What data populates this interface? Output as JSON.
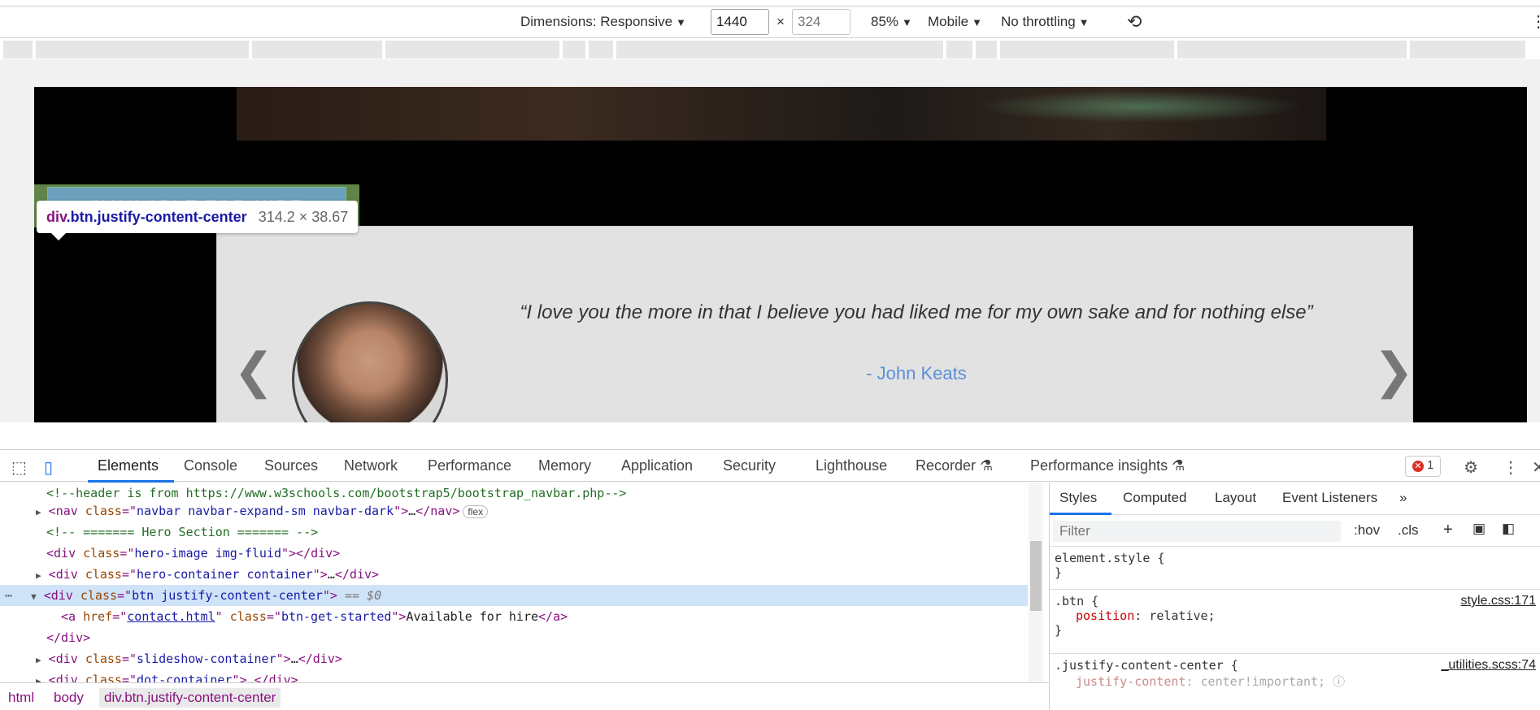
{
  "toolbar": {
    "dimensions_label": "Dimensions: Responsive",
    "width_value": "1440",
    "times": "×",
    "height_placeholder": "324",
    "zoom": "85%",
    "device_mode": "Mobile",
    "throttling": "No throttling"
  },
  "page": {
    "button_text": "Available for hire",
    "tooltip": {
      "selector_tag": "div",
      "selector_classes": ".btn.justify-content-center",
      "size": "314.2 × 38.67"
    },
    "slideshow": {
      "quote": "“I love you the more in that I believe you had liked me for my own sake and for nothing else”",
      "author": "- John Keats",
      "prev": "❮",
      "next": "❯"
    }
  },
  "devtools": {
    "tabs": [
      "Elements",
      "Console",
      "Sources",
      "Network",
      "Performance",
      "Memory",
      "Application",
      "Security",
      "Lighthouse",
      "Recorder",
      "Performance insights"
    ],
    "error_count": "1",
    "elements": [
      {
        "comment": "<!--header is from https://www.w3schools.com/bootstrap5/bootstrap_navbar.php-->"
      },
      {
        "tag": "nav",
        "attr": "class",
        "value": "navbar navbar-expand-sm  navbar-dark",
        "tail": "…</nav>",
        "badge": "flex"
      },
      {
        "comment": "<!-- ======= Hero Section ======= -->"
      },
      {
        "tag": "div",
        "attr": "class",
        "value": "hero-image img-fluid",
        "tail": "></div>"
      },
      {
        "tag": "div",
        "attr": "class",
        "value": "hero-container container",
        "tail": ">…</div>"
      },
      {
        "tag": "div",
        "attr": "class",
        "value": "btn justify-content-center",
        "tail": ">",
        "marker": "== $0"
      },
      {
        "tag": "a",
        "attr": "href",
        "value": "contact.html",
        "attr2": "class",
        "value2": "btn-get-started",
        "text": "Available for hire",
        "close": "</a>"
      },
      {
        "close": "</div>"
      },
      {
        "tag": "div",
        "attr": "class",
        "value": "slideshow-container",
        "tail": ">…</div>"
      },
      {
        "tag": "div",
        "attr": "class",
        "value": "dot-container",
        "tail": ">…</div>"
      }
    ],
    "styles_tabs": [
      "Styles",
      "Computed",
      "Layout",
      "Event Listeners"
    ],
    "filter_placeholder": "Filter",
    "hov": ":hov",
    "cls": ".cls",
    "rules": [
      {
        "selector": "element.style {",
        "close": "}"
      },
      {
        "selector": ".btn {",
        "source": "style.css:171",
        "prop": "position",
        "val": "relative;",
        "close": "}"
      },
      {
        "selector": ".justify-content-center {",
        "source": "_utilities.scss:74",
        "prop": "justify-content",
        "val": "center!important;"
      }
    ],
    "breadcrumbs": [
      "html",
      "body",
      "div.btn.justify-content-center"
    ]
  }
}
